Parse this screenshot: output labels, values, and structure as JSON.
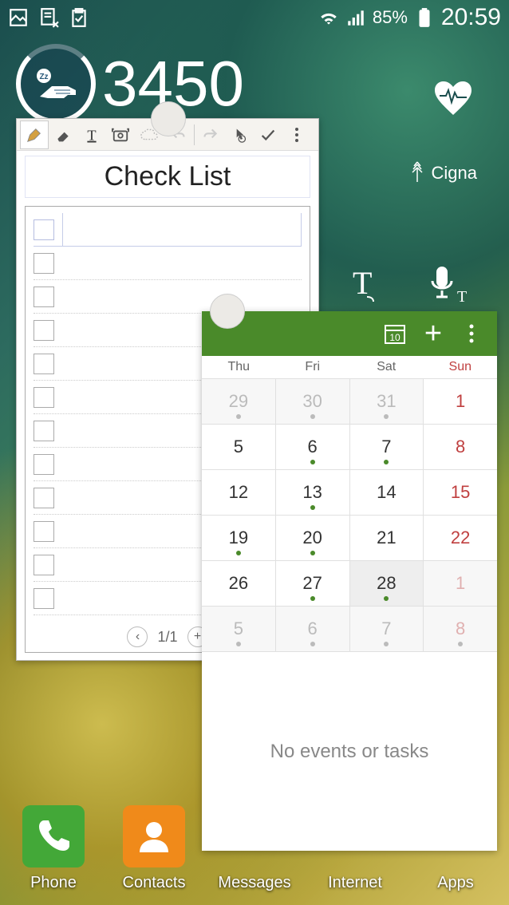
{
  "status_bar": {
    "battery_pct": "85%",
    "time": "20:59"
  },
  "health": {
    "steps": "3450",
    "partner": "Cigna"
  },
  "note": {
    "title": "Check List",
    "rows": 12,
    "page_current": "1",
    "page_total": "1",
    "pager_text": "1/1"
  },
  "calendar": {
    "day_headers": [
      "Thu",
      "Fri",
      "Sat",
      "Sun"
    ],
    "weeks": [
      [
        {
          "d": "29",
          "prev": true,
          "dot": true
        },
        {
          "d": "30",
          "prev": true,
          "dot": true
        },
        {
          "d": "31",
          "prev": true,
          "dot": true
        },
        {
          "d": "1",
          "sun": true
        }
      ],
      [
        {
          "d": "5"
        },
        {
          "d": "6",
          "dot": true
        },
        {
          "d": "7",
          "dot": true
        },
        {
          "d": "8",
          "sun": true
        }
      ],
      [
        {
          "d": "12"
        },
        {
          "d": "13",
          "dot": true
        },
        {
          "d": "14"
        },
        {
          "d": "15",
          "sun": true
        }
      ],
      [
        {
          "d": "19",
          "dot": true
        },
        {
          "d": "20",
          "dot": true
        },
        {
          "d": "21"
        },
        {
          "d": "22",
          "sun": true
        }
      ],
      [
        {
          "d": "26"
        },
        {
          "d": "27",
          "dot": true
        },
        {
          "d": "28",
          "dot": true,
          "today": true
        },
        {
          "d": "1",
          "sun": true,
          "next": true
        }
      ],
      [
        {
          "d": "5",
          "next": true,
          "dot": true
        },
        {
          "d": "6",
          "next": true,
          "dot": true
        },
        {
          "d": "7",
          "next": true,
          "dot": true
        },
        {
          "d": "8",
          "sun": true,
          "next": true,
          "dot": true
        }
      ]
    ],
    "today_box_label": "10",
    "no_events": "No events or tasks"
  },
  "dock": {
    "items": [
      {
        "label": "Phone"
      },
      {
        "label": "Contacts"
      },
      {
        "label": "Messages"
      },
      {
        "label": "Internet"
      },
      {
        "label": "Apps"
      }
    ]
  }
}
